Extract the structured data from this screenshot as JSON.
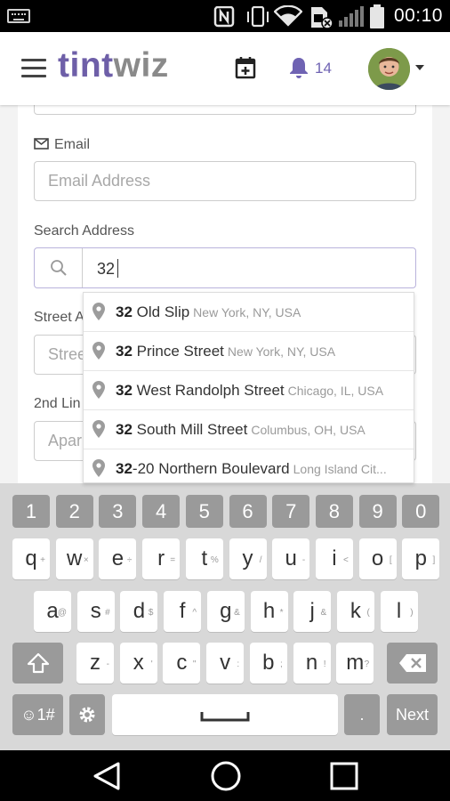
{
  "status_bar": {
    "time": "00:10"
  },
  "header": {
    "logo_part1": "tint",
    "logo_part2": "wiz",
    "notification_count": "14"
  },
  "form": {
    "email_label": "Email",
    "email_placeholder": "Email Address",
    "search_label": "Search Address",
    "search_value": "32",
    "street_label": "Street A",
    "street_placeholder": "Stree",
    "line2_label": "2nd Lin",
    "line2_placeholder": "Apar"
  },
  "suggestions": [
    {
      "match": "32",
      "rest": " Old Slip",
      "secondary": "New York, NY, USA"
    },
    {
      "match": "32",
      "rest": " Prince Street",
      "secondary": "New York, NY, USA"
    },
    {
      "match": "32",
      "rest": " West Randolph Street",
      "secondary": "Chicago, IL, USA"
    },
    {
      "match": "32",
      "rest": " South Mill Street",
      "secondary": "Columbus, OH, USA"
    },
    {
      "match": "32",
      "rest": "-20 Northern Boulevard",
      "secondary": "Long Island Cit..."
    }
  ],
  "keyboard": {
    "numbers": [
      "1",
      "2",
      "3",
      "4",
      "5",
      "6",
      "7",
      "8",
      "9",
      "0"
    ],
    "row1": [
      {
        "k": "q",
        "h": "+"
      },
      {
        "k": "w",
        "h": "×"
      },
      {
        "k": "e",
        "h": "÷"
      },
      {
        "k": "r",
        "h": "="
      },
      {
        "k": "t",
        "h": "%"
      },
      {
        "k": "y",
        "h": "/"
      },
      {
        "k": "u",
        "h": "-"
      },
      {
        "k": "i",
        "h": "<"
      },
      {
        "k": "o",
        "h": "["
      },
      {
        "k": "p",
        "h": "]"
      }
    ],
    "row2": [
      {
        "k": "a",
        "h": "@"
      },
      {
        "k": "s",
        "h": "#"
      },
      {
        "k": "d",
        "h": "$"
      },
      {
        "k": "f",
        "h": "^"
      },
      {
        "k": "g",
        "h": "&"
      },
      {
        "k": "h",
        "h": "*"
      },
      {
        "k": "j",
        "h": "&"
      },
      {
        "k": "k",
        "h": "("
      },
      {
        "k": "l",
        "h": ")"
      }
    ],
    "row3": [
      {
        "k": "z",
        "h": "-"
      },
      {
        "k": "x",
        "h": "'"
      },
      {
        "k": "c",
        "h": "\""
      },
      {
        "k": "v",
        "h": ":"
      },
      {
        "k": "b",
        "h": ";"
      },
      {
        "k": "n",
        "h": "!"
      },
      {
        "k": "m",
        "h": "?"
      }
    ],
    "symbols_label": "☺1#",
    "period_label": ".",
    "next_label": "Next"
  },
  "colors": {
    "brand_purple": "#6e5fa8",
    "brand_gray": "#8a8a8a",
    "badge": "#6f63b3"
  }
}
